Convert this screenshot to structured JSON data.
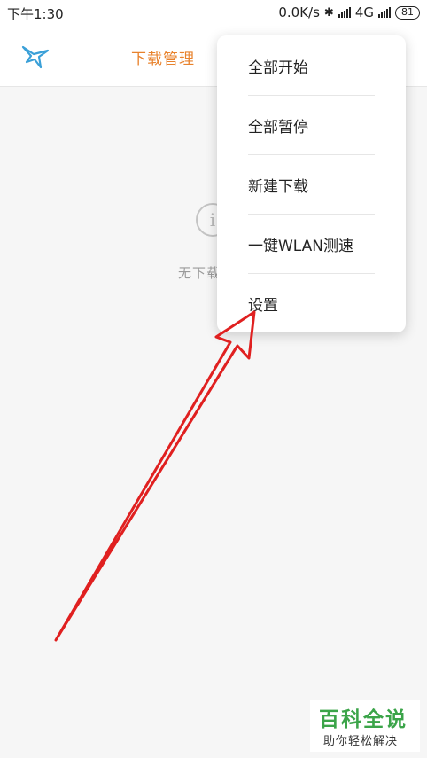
{
  "status_bar": {
    "time": "下午1:30",
    "net_speed": "0.0K/s",
    "network_type": "4G",
    "battery": "81"
  },
  "app_bar": {
    "logo_icon": "bird-logo-icon",
    "title": "下载管理"
  },
  "empty_state": {
    "icon": "info-circle-icon",
    "icon_glyph": "i",
    "text": "无下载"
  },
  "menu": {
    "items": [
      {
        "label": "全部开始"
      },
      {
        "label": "全部暂停"
      },
      {
        "label": "新建下载"
      },
      {
        "label": "一键WLAN测速"
      },
      {
        "label": "设置"
      }
    ]
  },
  "annotation": {
    "arrow_color": "#e02020"
  },
  "watermark": {
    "title": "百科全说",
    "subtitle": "助你轻松解决"
  },
  "colors": {
    "accent": "#e8822c",
    "logo": "#3aa0d8",
    "watermark_green": "#3ba449"
  }
}
